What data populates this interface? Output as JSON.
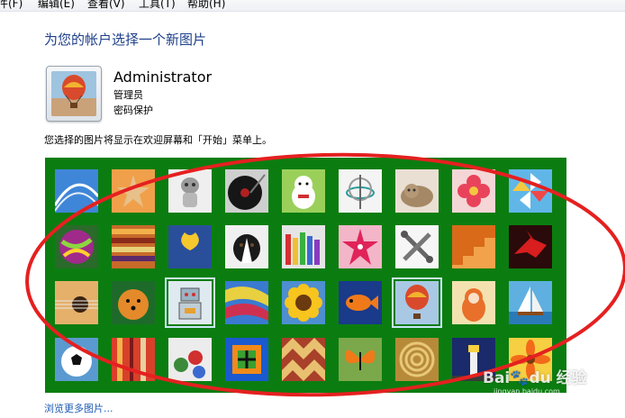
{
  "menu": [
    {
      "label": "件(F)"
    },
    {
      "label": "编辑(E)"
    },
    {
      "label": "查看(V)"
    },
    {
      "label": "工具(T)"
    },
    {
      "label": "帮助(H)"
    }
  ],
  "page": {
    "title": "为您的帐户选择一个新图片",
    "description": "您选择的图片将显示在欢迎屏幕和「开始」菜单上。",
    "browse_link": "浏览更多图片..."
  },
  "user": {
    "name": "Administrator",
    "role": "管理员",
    "password_status": "密码保护",
    "avatar": "hot-air-balloon"
  },
  "pictures": [
    {
      "name": "roller-coaster",
      "selected": false
    },
    {
      "name": "starfish",
      "selected": false
    },
    {
      "name": "robot-figure",
      "selected": false
    },
    {
      "name": "vinyl-record",
      "selected": false
    },
    {
      "name": "lucky-cat",
      "selected": false
    },
    {
      "name": "gyroscope",
      "selected": false
    },
    {
      "name": "kitten",
      "selected": false
    },
    {
      "name": "pink-flower",
      "selected": false
    },
    {
      "name": "pinwheel",
      "selected": false
    },
    {
      "name": "beach-ball",
      "selected": false
    },
    {
      "name": "fabric-rolls",
      "selected": false
    },
    {
      "name": "ginkgo-leaf",
      "selected": false
    },
    {
      "name": "border-collie",
      "selected": false
    },
    {
      "name": "crayons",
      "selected": false
    },
    {
      "name": "paper-star",
      "selected": false
    },
    {
      "name": "jacks",
      "selected": false
    },
    {
      "name": "stairs",
      "selected": false
    },
    {
      "name": "paper-crane",
      "selected": false
    },
    {
      "name": "guitar",
      "selected": false
    },
    {
      "name": "pomeranian",
      "selected": false
    },
    {
      "name": "toy-robot",
      "selected": true
    },
    {
      "name": "silk-scarves",
      "selected": false
    },
    {
      "name": "sunflower",
      "selected": false
    },
    {
      "name": "tropical-fish",
      "selected": false
    },
    {
      "name": "hot-air-balloon",
      "selected": true
    },
    {
      "name": "matryoshka",
      "selected": false
    },
    {
      "name": "sailboat",
      "selected": false
    },
    {
      "name": "soccer-ball",
      "selected": false
    },
    {
      "name": "textile",
      "selected": false
    },
    {
      "name": "marbles",
      "selected": false
    },
    {
      "name": "window-frame",
      "selected": false
    },
    {
      "name": "woven-pattern",
      "selected": false
    },
    {
      "name": "butterfly",
      "selected": false
    },
    {
      "name": "spiral-basket",
      "selected": false
    },
    {
      "name": "lighthouse",
      "selected": false
    },
    {
      "name": "orange-flower",
      "selected": false
    }
  ],
  "watermark": {
    "brand": "Bai",
    "brand2": "du",
    "tail": "经验",
    "url": "jingyan.baidu.com"
  },
  "colors": {
    "panel_green": "#0b7d10",
    "title_blue": "#1e3f8a",
    "link_blue": "#1e5ab4",
    "annotation_red": "#e52020"
  }
}
